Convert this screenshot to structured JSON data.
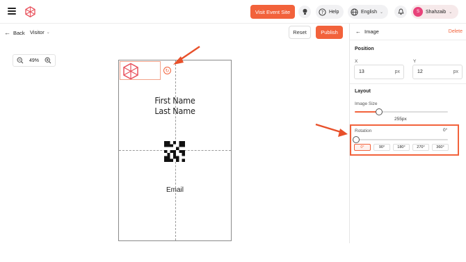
{
  "topbar": {
    "visit_label": "Visit Event Site",
    "help_label": "Help",
    "language_label": "English",
    "user_initial": "S",
    "user_name": "Shahzaib"
  },
  "subbar": {
    "back_label": "Back",
    "visitor_label": "Visitor",
    "reset_label": "Reset",
    "publish_label": "Publish"
  },
  "zoom": {
    "level": "49%"
  },
  "badge": {
    "first_name": "First Name",
    "last_name": "Last Name",
    "email": "Email"
  },
  "panel": {
    "title": "Image",
    "delete_label": "Delete",
    "position_title": "Position",
    "x_label": "X",
    "x_value": "13",
    "x_unit": "px",
    "y_label": "Y",
    "y_value": "12",
    "y_unit": "px",
    "layout_title": "Layout",
    "image_size_label": "Image Size",
    "image_size_value": "255px",
    "image_size_fraction": 0.26,
    "rotation_label": "Rotation",
    "rotation_value": "0°",
    "rotation_fraction": 0.0,
    "rotation_options": [
      "0°",
      "90°",
      "180°",
      "270°",
      "360°"
    ]
  },
  "colors": {
    "accent": "#f2623b",
    "annotation": "#e8502a"
  }
}
